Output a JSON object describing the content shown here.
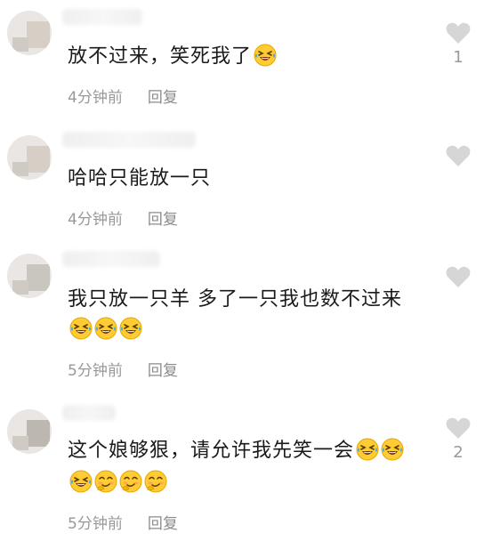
{
  "comments": [
    {
      "text": "放不过来，笑死我了",
      "emojis": [
        "rofl"
      ],
      "time": "4分钟前",
      "reply": "回复",
      "likes": "1"
    },
    {
      "text": "哈哈只能放一只",
      "emojis": [],
      "time": "4分钟前",
      "reply": "回复",
      "likes": ""
    },
    {
      "text": "我只放一只羊 多了一只我也数不过来",
      "emojis": [
        "rofl",
        "rofl",
        "rofl"
      ],
      "time": "5分钟前",
      "reply": "回复",
      "likes": ""
    },
    {
      "text": "这个娘够狠，请允许我先笑一会",
      "emojis_inline": [
        "rofl",
        "rofl"
      ],
      "emojis": [
        "rofl",
        "smirk",
        "smirk",
        "smirk"
      ],
      "time": "5分钟前",
      "reply": "回复",
      "likes": "2"
    }
  ],
  "colors": {
    "text": "#1a1a1a",
    "meta": "#999999",
    "heart": "#d6d6d6"
  },
  "icons": {
    "like": "heart-icon",
    "rofl": "rolling-laughing-emoji-icon",
    "smirk": "smirk-emoji-icon"
  }
}
